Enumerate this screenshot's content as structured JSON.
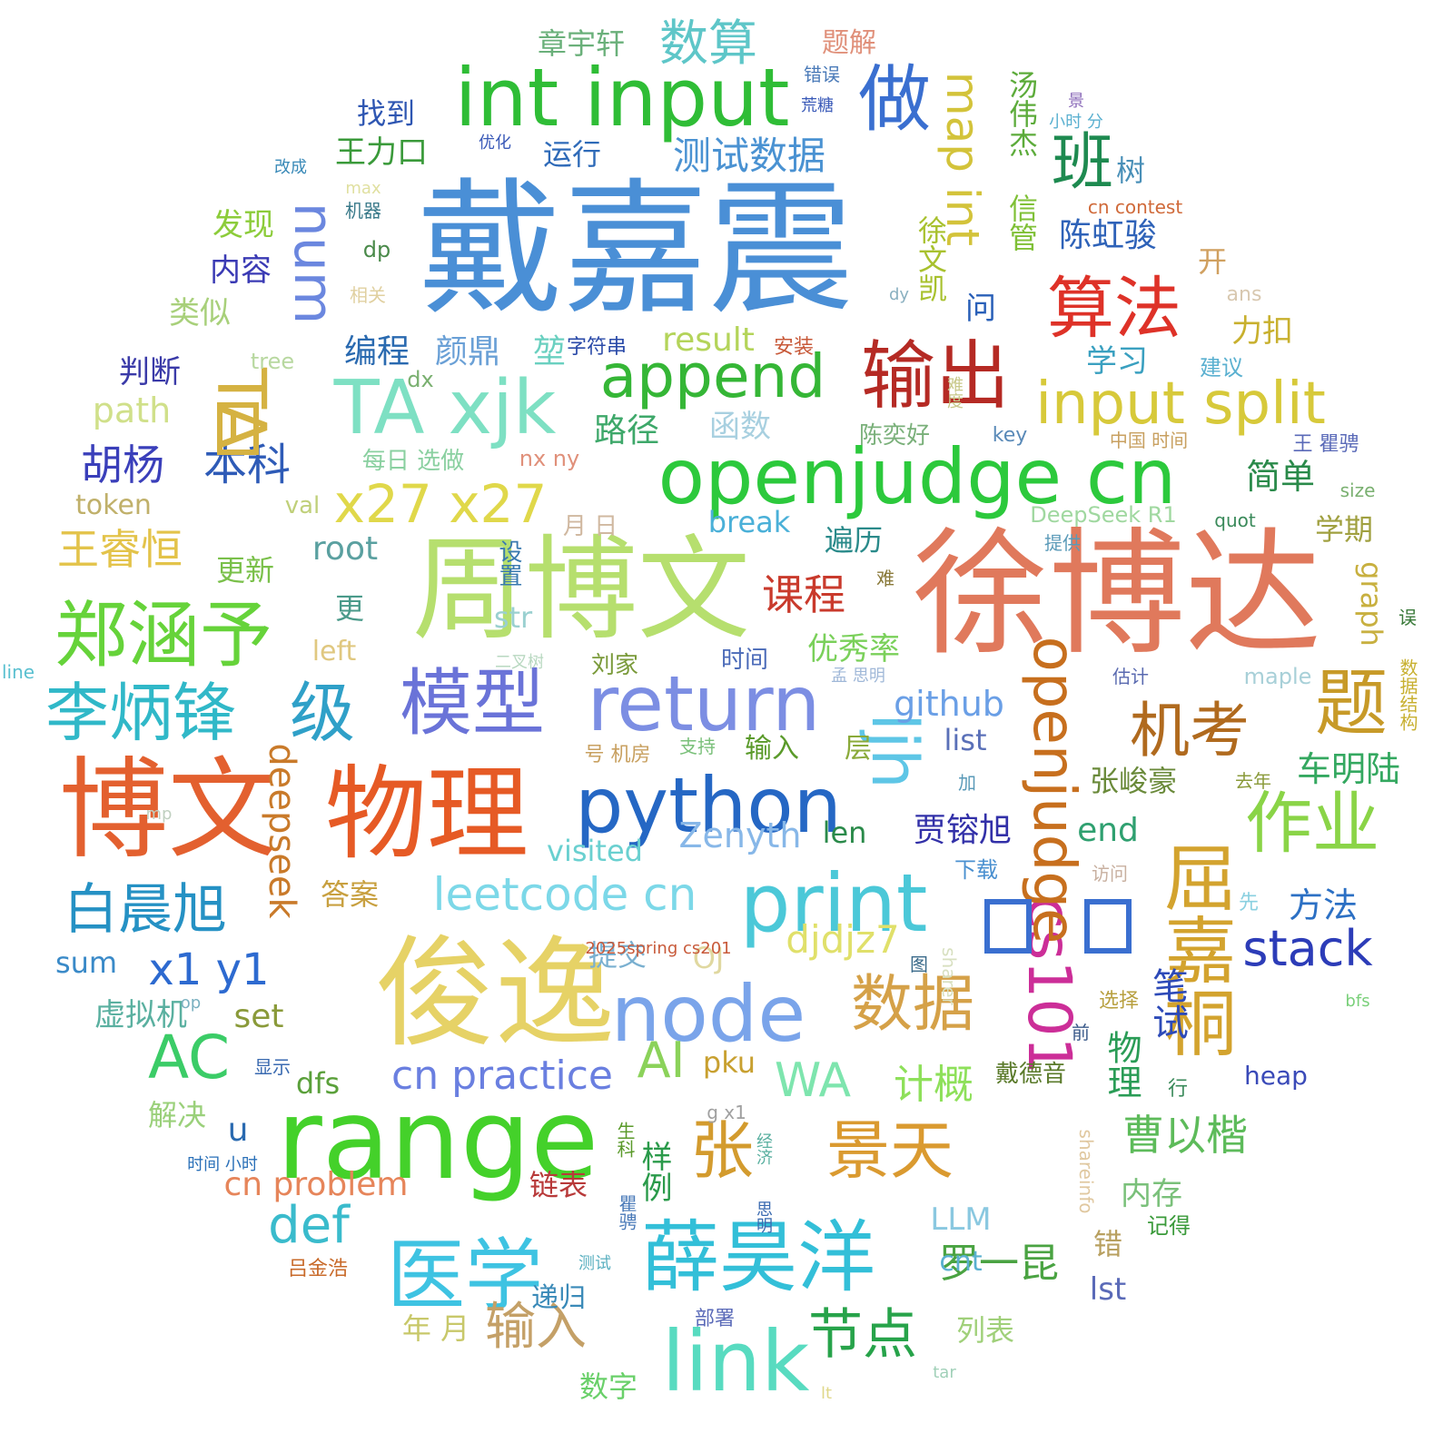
{
  "words": [
    {
      "text": "戴嘉震",
      "color": "#4a8fd6"
    },
    {
      "text": "徐博达",
      "color": "#e0795c"
    },
    {
      "text": "周博文",
      "color": "#b6df6e"
    },
    {
      "text": "俊逸",
      "color": "#e6d266"
    },
    {
      "text": "博文",
      "color": "#e3602f"
    },
    {
      "text": "物理",
      "color": "#e65a25"
    },
    {
      "text": "range",
      "color": "#44d12a"
    },
    {
      "text": "int input",
      "color": "#2fbd36"
    },
    {
      "text": "openjudge cn",
      "color": "#2cc93c"
    },
    {
      "text": "return",
      "color": "#7c8ee3"
    },
    {
      "text": "python",
      "color": "#2567c4"
    },
    {
      "text": "node",
      "color": "#7aa4ea"
    },
    {
      "text": "link",
      "color": "#58dbc0"
    },
    {
      "text": "print",
      "color": "#4bc8d8"
    },
    {
      "text": "医学",
      "color": "#3ec3e2"
    },
    {
      "text": "薛昊洋",
      "color": "#33bfd8"
    },
    {
      "text": "模型",
      "color": "#6a73d8"
    },
    {
      "text": "李炳锋",
      "color": "#30b8c8"
    },
    {
      "text": "级",
      "color": "#2fa0c8"
    },
    {
      "text": "郑涵予",
      "color": "#66d33a"
    },
    {
      "text": "TA xjk",
      "color": "#7ee0c3"
    },
    {
      "text": "append",
      "color": "#35b636"
    },
    {
      "text": "输出",
      "color": "#b52a24"
    },
    {
      "text": "做",
      "color": "#3a6fd0"
    },
    {
      "text": "算法",
      "color": "#de3228"
    },
    {
      "text": "班",
      "color": "#1e8a50"
    },
    {
      "text": "input split",
      "color": "#d7c93a"
    },
    {
      "text": "机考",
      "color": "#b06a1e"
    },
    {
      "text": "题",
      "color": "#c79a28"
    },
    {
      "text": "作业",
      "color": "#8ad447"
    },
    {
      "text": "屈嘉桐",
      "color": "#d3a32e"
    },
    {
      "text": "数据",
      "color": "#d5a148"
    },
    {
      "text": "张",
      "color": "#d39b2e"
    },
    {
      "text": "景天",
      "color": "#da9a30"
    },
    {
      "text": "节点",
      "color": "#27a34a"
    },
    {
      "text": "输入",
      "color": "#c4a067"
    },
    {
      "text": "ljh",
      "color": "#5ec6e6"
    },
    {
      "text": "AI",
      "color": "#8bd25a"
    },
    {
      "text": "WA",
      "color": "#7ee5ae"
    },
    {
      "text": "AC",
      "color": "#3bcc67"
    },
    {
      "text": "白晨旭",
      "color": "#2591c4"
    },
    {
      "text": "x27 x27",
      "color": "#e0d84a"
    },
    {
      "text": "胡杨",
      "color": "#3a3fba"
    },
    {
      "text": "本科",
      "color": "#2e5bb7"
    },
    {
      "text": "王睿恒",
      "color": "#e3c34a"
    },
    {
      "text": "num",
      "color": "#6b87df"
    },
    {
      "text": "TA",
      "color": "#d5b242"
    },
    {
      "text": "map int",
      "color": "#d3c33a"
    },
    {
      "text": "cs101",
      "color": "#cc2e98"
    },
    {
      "text": "openjudge",
      "color": "#c76f1e"
    },
    {
      "text": "stack",
      "color": "#2c3cb8"
    },
    {
      "text": "数算",
      "color": "#5ec6c8"
    },
    {
      "text": "测试数据",
      "color": "#4a92d2"
    },
    {
      "text": "leetcode cn",
      "color": "#7cd8e8"
    },
    {
      "text": "cn practice",
      "color": "#6a7fe0"
    },
    {
      "text": "课程",
      "color": "#c93a2c"
    },
    {
      "text": "计概",
      "color": "#8ee05a"
    },
    {
      "text": "曹以楷",
      "color": "#5dbb5a"
    },
    {
      "text": "罗一昆",
      "color": "#4aa342"
    },
    {
      "text": "def",
      "color": "#3abbcc"
    },
    {
      "text": "cn problem",
      "color": "#e6855a"
    },
    {
      "text": "x1 y1",
      "color": "#2d6ad0"
    },
    {
      "text": "djdjz7",
      "color": "#e0e06a"
    },
    {
      "text": "github",
      "color": "#6a9fe6"
    },
    {
      "text": "Zenyth",
      "color": "#87b7e8"
    },
    {
      "text": "deepseek",
      "color": "#c97a2a"
    },
    {
      "text": "车明陆",
      "color": "#34a860"
    },
    {
      "text": "方法",
      "color": "#2c70c4"
    },
    {
      "text": "笔试",
      "color": "#2d4ab8"
    },
    {
      "text": "物理",
      "color": "#2a9c56"
    },
    {
      "text": "简单",
      "color": "#2a8a4a"
    },
    {
      "text": "贾镕旭",
      "color": "#3230a8"
    },
    {
      "text": "张峻豪",
      "color": "#6a8a3a"
    },
    {
      "text": "end",
      "color": "#2fa070"
    },
    {
      "text": "陈虹骏",
      "color": "#2e62b8"
    },
    {
      "text": "徐文凯",
      "color": "#a8c12e"
    },
    {
      "text": "信管",
      "color": "#7fc036"
    },
    {
      "text": "汤伟杰",
      "color": "#5cab3a"
    },
    {
      "text": "优秀率",
      "color": "#7ad05a"
    },
    {
      "text": "路径",
      "color": "#3ea86a"
    },
    {
      "text": "函数",
      "color": "#a8d0e0"
    },
    {
      "text": "遍历",
      "color": "#2a8a8a"
    },
    {
      "text": "颜鼎",
      "color": "#6aa0d6"
    },
    {
      "text": "堃",
      "color": "#6ad0c0"
    },
    {
      "text": "编程",
      "color": "#2a6ab0"
    },
    {
      "text": "result",
      "color": "#b4d45a"
    },
    {
      "text": "学习",
      "color": "#3aa0c0"
    },
    {
      "text": "力扣",
      "color": "#c8b02e"
    },
    {
      "text": "问",
      "color": "#2a60b8"
    },
    {
      "text": "开",
      "color": "#d0a060"
    },
    {
      "text": "运行",
      "color": "#2e6ab8"
    },
    {
      "text": "找到",
      "color": "#2e56b2"
    },
    {
      "text": "王力口",
      "color": "#3a9a3a"
    },
    {
      "text": "章宇轩",
      "color": "#6ab07a"
    },
    {
      "text": "题解",
      "color": "#e0907a"
    },
    {
      "text": "发现",
      "color": "#8ccc3a"
    },
    {
      "text": "内容",
      "color": "#3a3ab4"
    },
    {
      "text": "类似",
      "color": "#a8d07a"
    },
    {
      "text": "判断",
      "color": "#3a3aa8"
    },
    {
      "text": "path",
      "color": "#d0e08a"
    },
    {
      "text": "token",
      "color": "#c0b06a"
    },
    {
      "text": "更新",
      "color": "#7ac04a"
    },
    {
      "text": "root",
      "color": "#5aa0a0"
    },
    {
      "text": "更",
      "color": "#4a9a8a"
    },
    {
      "text": "left",
      "color": "#e0c880"
    },
    {
      "text": "str",
      "color": "#9ad0d0"
    },
    {
      "text": "break",
      "color": "#4ab0d8"
    },
    {
      "text": "OJ",
      "color": "#e0d8a0"
    },
    {
      "text": "答案",
      "color": "#c8a040"
    },
    {
      "text": "提交",
      "color": "#7ab0d0"
    },
    {
      "text": "visited",
      "color": "#6ad0d0"
    },
    {
      "text": "len",
      "color": "#2a8a4a"
    },
    {
      "text": "输入",
      "color": "#5a9a2a"
    },
    {
      "text": "层",
      "color": "#8aaa3a"
    },
    {
      "text": "list",
      "color": "#5a70b8"
    },
    {
      "text": "dfs",
      "color": "#5aa03a"
    },
    {
      "text": "pku",
      "color": "#c8a030"
    },
    {
      "text": "样例",
      "color": "#2a9a4a"
    },
    {
      "text": "链表",
      "color": "#b83a3a"
    },
    {
      "text": "年 月",
      "color": "#c8c86a"
    },
    {
      "text": "数字",
      "color": "#6ad06a"
    },
    {
      "text": "列表",
      "color": "#a0d07a"
    },
    {
      "text": "递归",
      "color": "#3a8ab8"
    },
    {
      "text": "LLM",
      "color": "#8ac8e0"
    },
    {
      "text": "cnt",
      "color": "#5ab0d0"
    },
    {
      "text": "lst",
      "color": "#5a6ab8"
    },
    {
      "text": "错",
      "color": "#b8a060"
    },
    {
      "text": "内存",
      "color": "#7ac07a"
    },
    {
      "text": "sum",
      "color": "#3a8ac8"
    },
    {
      "text": "set",
      "color": "#8a9a3a"
    },
    {
      "text": "u",
      "color": "#2a6ab0"
    },
    {
      "text": "虚拟机",
      "color": "#5ab0a0"
    },
    {
      "text": "解决",
      "color": "#9ad07a"
    },
    {
      "text": "学期",
      "color": "#a0a040"
    },
    {
      "text": "graph",
      "color": "#c8b040"
    },
    {
      "text": "heap",
      "color": "#3a4ab8"
    },
    {
      "text": "戴德音",
      "color": "#5a7a2a"
    },
    {
      "text": "树",
      "color": "#4a90b8"
    },
    {
      "text": "陈奕好",
      "color": "#7ab07a"
    },
    {
      "text": "每日 选做",
      "color": "#8ad0a0"
    },
    {
      "text": "nx ny",
      "color": "#e0907a"
    },
    {
      "text": "月 日",
      "color": "#d0b8a0"
    },
    {
      "text": "设置",
      "color": "#3a7ab0"
    },
    {
      "text": "val",
      "color": "#c0d07a"
    },
    {
      "text": "tree",
      "color": "#b8d8a0"
    },
    {
      "text": "dx",
      "color": "#7ab070"
    },
    {
      "text": "字符串",
      "color": "#2a4aa8"
    },
    {
      "text": "安装",
      "color": "#c85a3a"
    },
    {
      "text": "建议",
      "color": "#5ab0d0"
    },
    {
      "text": "key",
      "color": "#5a8ab8"
    },
    {
      "text": "中国 时间",
      "color": "#c8a060"
    },
    {
      "text": "王 瞿骋",
      "color": "#5a6ab8"
    },
    {
      "text": "size",
      "color": "#7ab070"
    },
    {
      "text": "quot",
      "color": "#3a8a5a"
    },
    {
      "text": "DeepSeek R1",
      "color": "#a0d8a0"
    },
    {
      "text": "提供",
      "color": "#5a9ab8"
    },
    {
      "text": "难",
      "color": "#8a7a3a"
    },
    {
      "text": "误",
      "color": "#3a7a3a"
    },
    {
      "text": "数据结构",
      "color": "#c8b030"
    },
    {
      "text": "maple",
      "color": "#a8d0d8"
    },
    {
      "text": "估计",
      "color": "#5a6ab0"
    },
    {
      "text": "孟 思明",
      "color": "#a0b8d8"
    },
    {
      "text": "时间",
      "color": "#4a6ab8"
    },
    {
      "text": "刘家",
      "color": "#7a9a3a"
    },
    {
      "text": "二叉树",
      "color": "#b8d8c0"
    },
    {
      "text": "line",
      "color": "#5ac0d0"
    },
    {
      "text": "op",
      "color": "#7ab0c0"
    },
    {
      "text": "号 机房",
      "color": "#c8a060"
    },
    {
      "text": "支持",
      "color": "#7ac07a"
    },
    {
      "text": "加",
      "color": "#5a9ab8"
    },
    {
      "text": "去年",
      "color": "#8a9a3a"
    },
    {
      "text": "mp",
      "color": "#c0d0c0"
    },
    {
      "text": "下载",
      "color": "#4a90d0"
    },
    {
      "text": "访问",
      "color": "#c8b0a0"
    },
    {
      "text": "先",
      "color": "#8ad0e0"
    },
    {
      "text": "sharer",
      "color": "#d8e0c0"
    },
    {
      "text": "2025spring cs201",
      "color": "#c85a3a"
    },
    {
      "text": "图",
      "color": "#3a6a8a"
    },
    {
      "text": "选择",
      "color": "#b8a040"
    },
    {
      "text": "前",
      "color": "#3a5a8a"
    },
    {
      "text": "bfs",
      "color": "#7ad07a"
    },
    {
      "text": "显示",
      "color": "#3a6ab0"
    },
    {
      "text": "g x1",
      "color": "#a0a0a0"
    },
    {
      "text": "生科",
      "color": "#5a9a2a"
    },
    {
      "text": "经济",
      "color": "#5ab0a0"
    },
    {
      "text": "行",
      "color": "#3a8a5a"
    },
    {
      "text": "shareinfo",
      "color": "#e0c8a0"
    },
    {
      "text": "瞿骋",
      "color": "#4a7ab8"
    },
    {
      "text": "思明",
      "color": "#3a6ab0"
    },
    {
      "text": "时间 小时",
      "color": "#2a70b8"
    },
    {
      "text": "记得",
      "color": "#3a9a3a"
    },
    {
      "text": "测试",
      "color": "#5ab0c0"
    },
    {
      "text": "吕金浩",
      "color": "#c86a2a"
    },
    {
      "text": "部署",
      "color": "#5a6ab8"
    },
    {
      "text": "tar",
      "color": "#a0d0b8"
    },
    {
      "text": "lt",
      "color": "#e0d88a"
    },
    {
      "text": "ans",
      "color": "#d8c8b0"
    },
    {
      "text": "dy",
      "color": "#8ab0c0"
    },
    {
      "text": "相关",
      "color": "#e0d0a0"
    },
    {
      "text": "dp",
      "color": "#4a8a4a"
    },
    {
      "text": "机器",
      "color": "#3a7a8a"
    },
    {
      "text": "max",
      "color": "#e0e0a0"
    },
    {
      "text": "改成",
      "color": "#3a8ab8"
    },
    {
      "text": "优化",
      "color": "#3a5ab8"
    },
    {
      "text": "错误",
      "color": "#4a7ab8"
    },
    {
      "text": "荒糖",
      "color": "#3a5ab8"
    },
    {
      "text": "景",
      "color": "#8a6ab8"
    },
    {
      "text": "小时 分",
      "color": "#5ab0d0"
    },
    {
      "text": "cn contest",
      "color": "#d06a3a"
    },
    {
      "text": "难度",
      "color": "#c8c88a"
    }
  ]
}
